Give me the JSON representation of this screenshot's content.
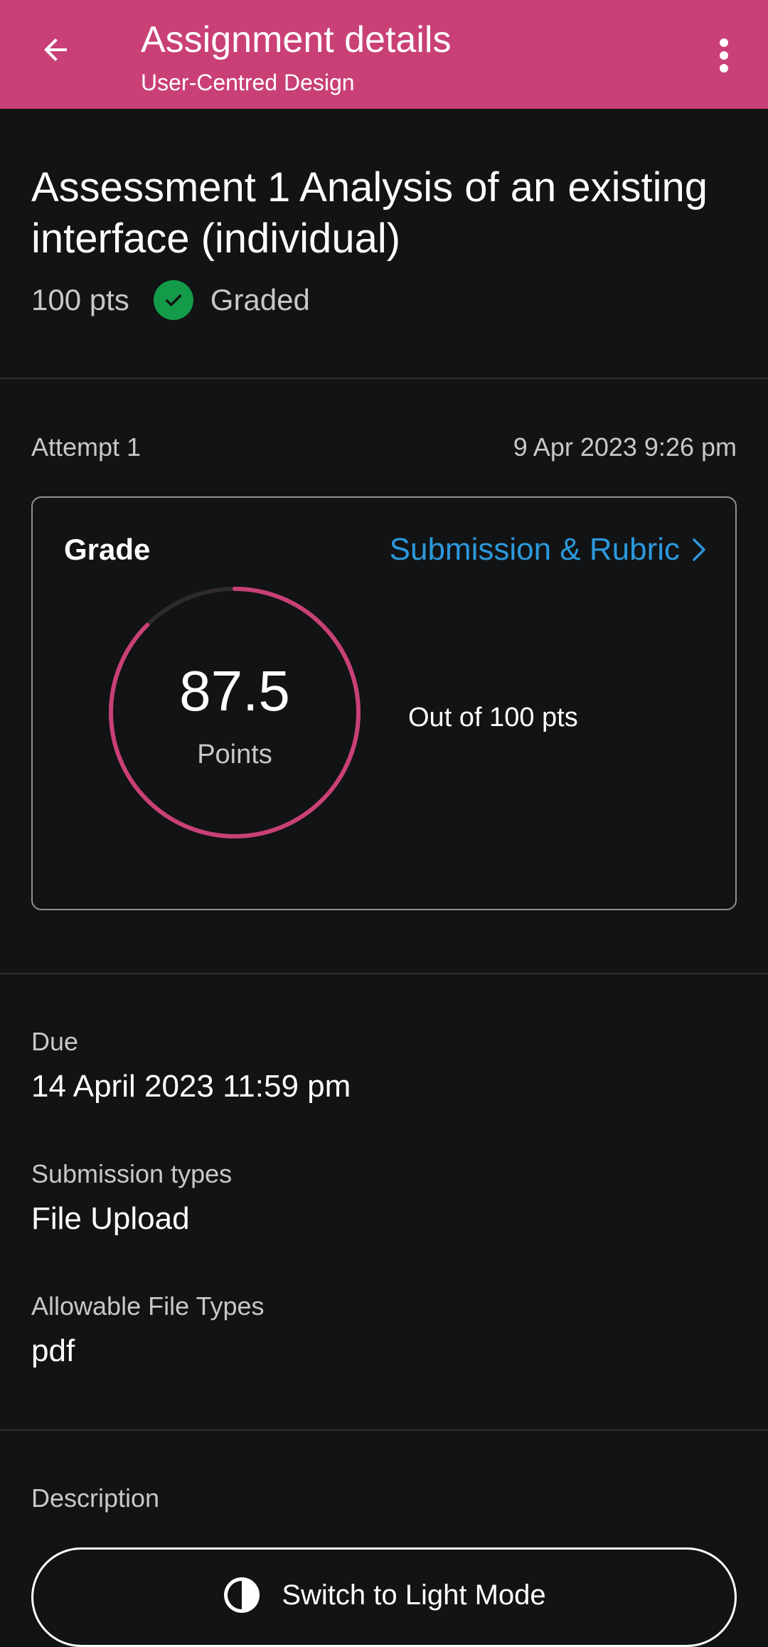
{
  "app_bar": {
    "title": "Assignment details",
    "subtitle": "User-Centred Design",
    "back_icon": "arrow-left-icon",
    "more_icon": "more-vertical-icon",
    "color": "#c94077"
  },
  "assignment": {
    "title": "Assessment 1 Analysis of an existing interface (individual)",
    "points": "100 pts",
    "status": "Graded",
    "status_color": "#139b49"
  },
  "attempt": {
    "label": "Attempt 1",
    "date": "9 Apr 2023 9:26 pm"
  },
  "grade": {
    "label": "Grade",
    "link_label": "Submission & Rubric",
    "score": "87.5",
    "score_caption": "Points",
    "out_of": "Out of 100 pts",
    "score_fraction": 0.875,
    "ring_color": "#c94077",
    "link_color": "#2b99dc"
  },
  "details": {
    "due_label": "Due",
    "due_value": "14 April 2023 11:59 pm",
    "submission_types_label": "Submission types",
    "submission_types_value": "File Upload",
    "file_types_label": "Allowable File Types",
    "file_types_value": "pdf",
    "description_label": "Description"
  },
  "theme_button": {
    "label": "Switch to Light Mode",
    "icon": "contrast-icon"
  }
}
